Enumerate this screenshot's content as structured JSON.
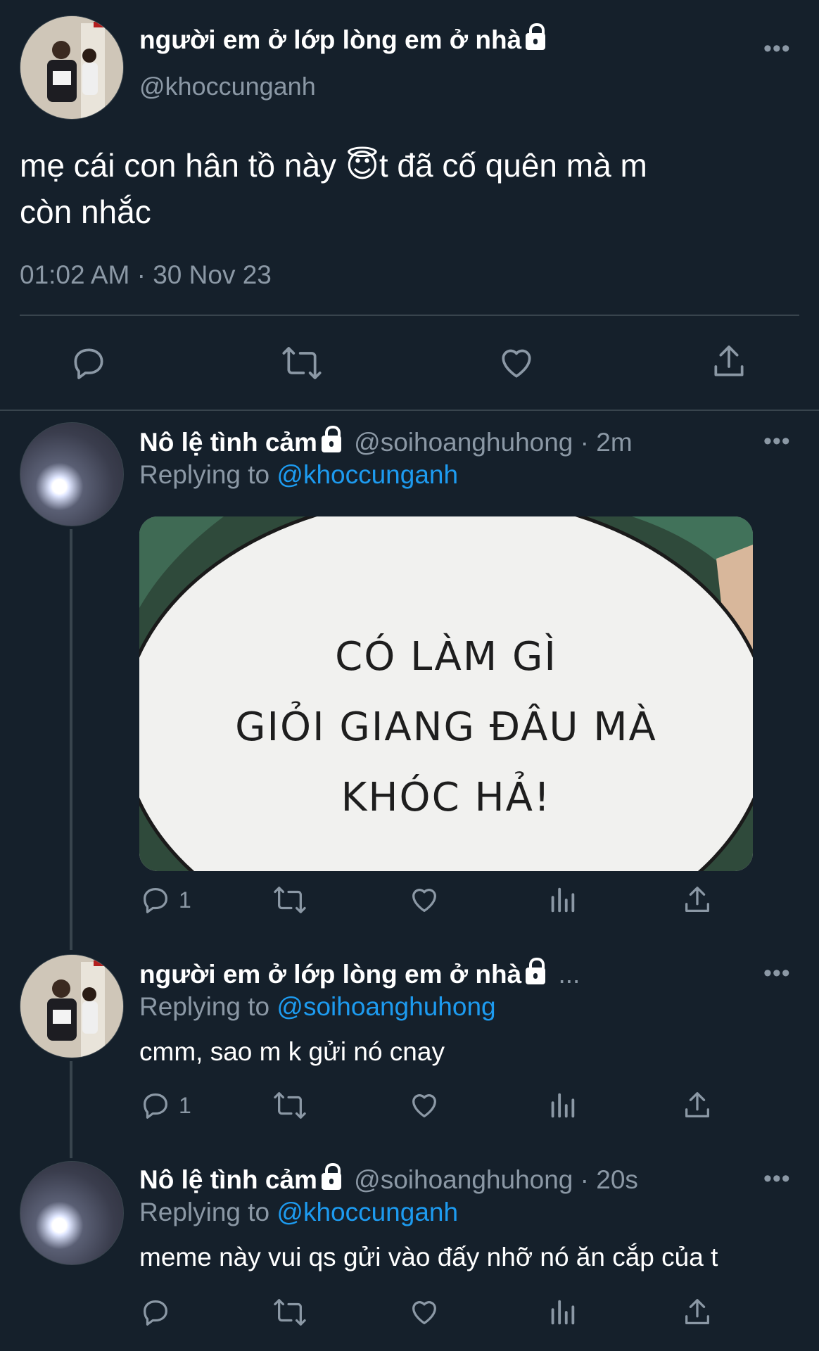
{
  "main_tweet": {
    "display_name": "người em ở lớp lòng em ở nhà",
    "handle": "@khoccunganh",
    "more": "•••",
    "text_line1_before_emoji": "mẹ cái con hân tồ này ",
    "emoji": "😇",
    "text_line1_after_emoji": "t đã cố quên mà m",
    "text_line2": "còn nhắc",
    "timestamp": "01:02 AM · 30 Nov 23"
  },
  "replies": [
    {
      "display_name": "Nô lệ tình cảm",
      "handle_time": "@soihoanghuhong · 2m",
      "replying_label": "Replying to ",
      "replying_to": "@khoccunganh",
      "image_text": [
        "CÓ LÀM GÌ",
        "GIỎI GIANG ĐÂU MÀ",
        "KHÓC HẢ!"
      ],
      "reply_count": "1",
      "more": "•••"
    },
    {
      "display_name": "người em ở lớp lòng em ở nhà",
      "handle_time": "...",
      "replying_label": "Replying to ",
      "replying_to": "@soihoanghuhong",
      "text": "cmm, sao m k gửi nó cnay",
      "reply_count": "1",
      "more": "•••"
    },
    {
      "display_name": "Nô lệ tình cảm",
      "handle_time": "@soihoanghuhong · 20s",
      "replying_label": "Replying to ",
      "replying_to": "@khoccunganh",
      "text": "meme này vui qs gửi vào đấy nhỡ nó ăn cắp của t",
      "reply_count": "",
      "more": "•••"
    }
  ],
  "colors": {
    "background": "#15202b",
    "secondary_text": "#8b98a5",
    "link": "#1d9bf0",
    "divider": "#38444d"
  }
}
